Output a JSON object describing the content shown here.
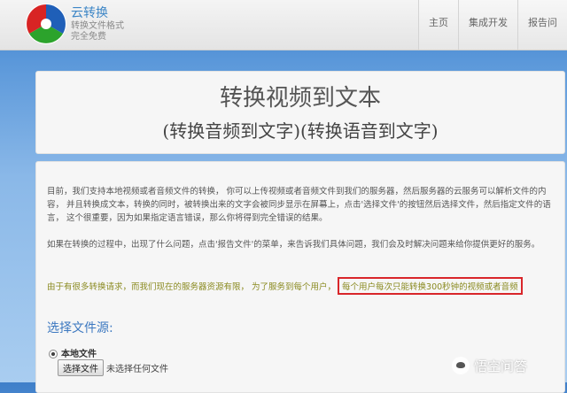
{
  "brand": {
    "title": "云转换",
    "subtitle1": "转换文件格式",
    "subtitle2": "完全免费"
  },
  "nav": {
    "items": [
      "主页",
      "集成开发",
      "报告问"
    ]
  },
  "header": {
    "title": "转换视频到文本",
    "subtitle": "(转换音频到文字)(转换语音到文字)"
  },
  "content": {
    "paragraph1": "目前，我们支持本地视频或者音频文件的转换，  你可以上传视频或者音频文件到我们的服务器，然后服务器的云服务可以解析文件的内容，  并且转换成文本，转换的同时，被转换出来的文字会被同步显示在屏幕上，点击'选择文件'的按钮然后选择文件，然后指定文件的语言，  这个很重要，因为如果指定语言错误，那么你将得到完全错误的结果。",
    "paragraph2": "如果在转换的过程中，出现了什么问题，点击'报告文件'的菜单，来告诉我们具体问题，我们会及时解决问题来给你提供更好的服务。",
    "notice_text": "由于有很多转换请求，而我们现在的服务器资源有限，  为了服务到每个用户，",
    "notice_highlight": "每个用户每次只能转换300秒钟的视频或者音频"
  },
  "file_source": {
    "heading": "选择文件源:",
    "option_label": "本地文件",
    "button_label": "选择文件",
    "status": "未选择任何文件"
  },
  "watermark": {
    "text": "悟空问答"
  },
  "colors": {
    "brand_blue": "#3d86c6",
    "highlight_border": "#d9262a",
    "notice_text": "#8a8a20"
  }
}
